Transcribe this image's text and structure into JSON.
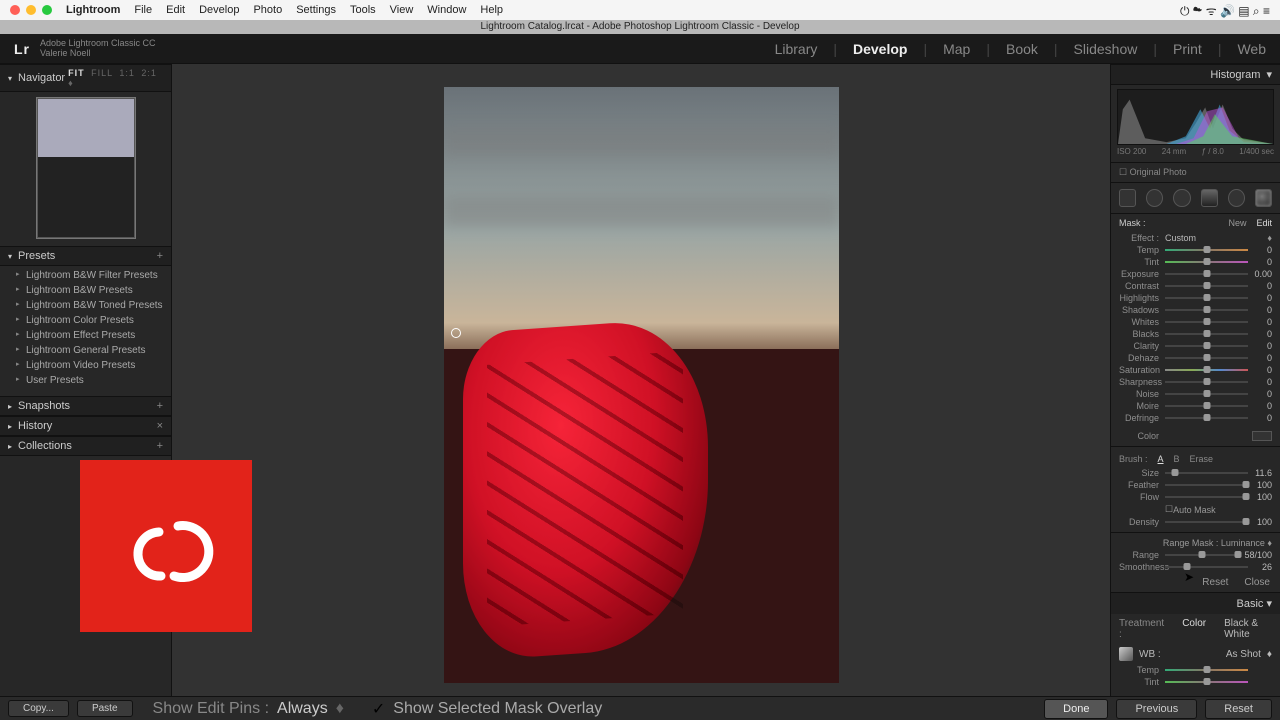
{
  "menubar": {
    "app_title": "Lightroom",
    "items": [
      "File",
      "Edit",
      "Develop",
      "Photo",
      "Settings",
      "Tools",
      "View",
      "Window",
      "Help"
    ]
  },
  "window_title": "Lightroom Catalog.lrcat - Adobe Photoshop Lightroom Classic - Develop",
  "lr_header": {
    "logo": "Lr",
    "sub1": "Adobe Lightroom Classic CC",
    "sub2": "Valerie Noell"
  },
  "modules": [
    "Library",
    "Develop",
    "Map",
    "Book",
    "Slideshow",
    "Print",
    "Web"
  ],
  "active_module": "Develop",
  "navigator": {
    "label": "Navigator",
    "modes": [
      "FIT",
      "FILL",
      "1:1",
      "2:1"
    ],
    "active_mode": "FIT"
  },
  "presets": {
    "label": "Presets",
    "items": [
      "Lightroom B&W Filter Presets",
      "Lightroom B&W Presets",
      "Lightroom B&W Toned Presets",
      "Lightroom Color Presets",
      "Lightroom Effect Presets",
      "Lightroom General Presets",
      "Lightroom Video Presets",
      "User Presets"
    ]
  },
  "snapshots_label": "Snapshots",
  "history_label": "History",
  "collections_label": "Collections",
  "copy_label": "Copy...",
  "paste_label": "Paste",
  "toolbar_text": "Show Edit Pins :",
  "toolbar_value": "Always",
  "overlay_check": "Show Selected Mask Overlay",
  "done_label": "Done",
  "previous_label": "Previous",
  "reset_label": "Reset",
  "histogram_label": "Histogram",
  "histo_info": {
    "iso": "ISO 200",
    "lens": "24 mm",
    "ap": "ƒ / 8.0",
    "sh": "1/400 sec"
  },
  "original_photo": "Original Photo",
  "mask_row": {
    "label": "Mask :",
    "new": "New",
    "edit": "Edit"
  },
  "effect_row": {
    "label": "Effect :",
    "value": "Custom"
  },
  "sliders1": [
    {
      "label": "Temp",
      "value": "0",
      "cls": "temp"
    },
    {
      "label": "Tint",
      "value": "0",
      "cls": "tint"
    }
  ],
  "sliders2": [
    {
      "label": "Exposure",
      "value": "0.00"
    },
    {
      "label": "Contrast",
      "value": "0"
    },
    {
      "label": "Highlights",
      "value": "0"
    },
    {
      "label": "Shadows",
      "value": "0"
    },
    {
      "label": "Whites",
      "value": "0"
    },
    {
      "label": "Blacks",
      "value": "0"
    }
  ],
  "sliders3": [
    {
      "label": "Clarity",
      "value": "0"
    },
    {
      "label": "Dehaze",
      "value": "0"
    },
    {
      "label": "Saturation",
      "value": "0",
      "cls": "sat"
    }
  ],
  "sliders4": [
    {
      "label": "Sharpness",
      "value": "0"
    },
    {
      "label": "Noise",
      "value": "0"
    },
    {
      "label": "Moire",
      "value": "0"
    },
    {
      "label": "Defringe",
      "value": "0"
    }
  ],
  "color_label": "Color",
  "brush": {
    "label": "Brush :",
    "a": "A",
    "b": "B",
    "erase": "Erase"
  },
  "brush_sliders": [
    {
      "label": "Size",
      "value": "11.6",
      "pos": 12
    },
    {
      "label": "Feather",
      "value": "100",
      "pos": 98
    },
    {
      "label": "Flow",
      "value": "100",
      "pos": 98
    }
  ],
  "automask": "Auto Mask",
  "density": {
    "label": "Density",
    "value": "100",
    "pos": 98
  },
  "rangemask": {
    "label": "Range Mask :",
    "value": "Luminance"
  },
  "range": {
    "label": "Range",
    "value": "58/100",
    "lo": 50,
    "hi": 100
  },
  "smoothness": {
    "label": "Smoothness",
    "value": "26",
    "pos": 26
  },
  "rb_reset": "Reset",
  "rb_close": "Close",
  "basic_label": "Basic",
  "treatment": {
    "label": "Treatment :",
    "color": "Color",
    "bw": "Black & White"
  },
  "wb": {
    "label": "WB :",
    "value": "As Shot"
  },
  "basic_sliders": [
    {
      "label": "Temp",
      "value": "",
      "cls": "temp"
    },
    {
      "label": "Tint",
      "value": "",
      "cls": "tint"
    }
  ]
}
